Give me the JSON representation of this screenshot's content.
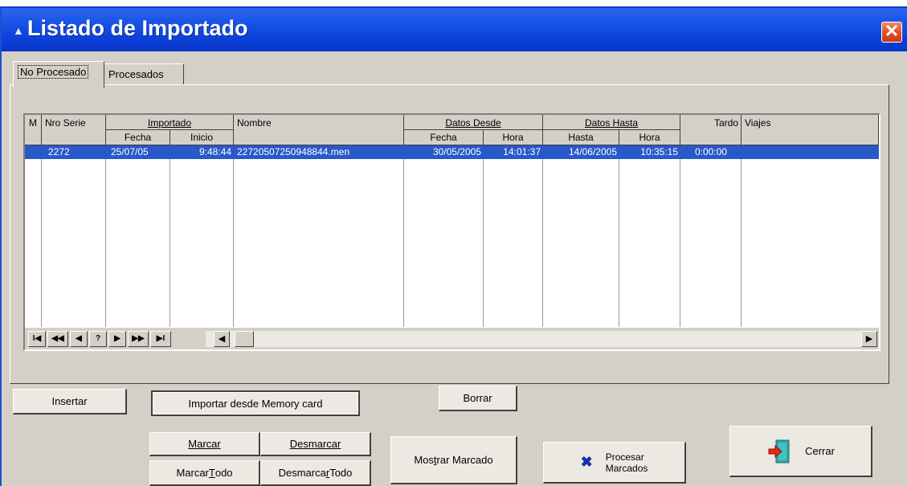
{
  "window": {
    "title": "Listado de Importado",
    "close_symbol": "✕"
  },
  "tabs": [
    {
      "label": "No Procesado",
      "active": true
    },
    {
      "label": "Procesados",
      "active": false
    }
  ],
  "grid": {
    "headers": {
      "m": "M",
      "nro_serie": "Nro Serie",
      "importado": "Importado",
      "importado_fecha": "Fecha",
      "importado_inicio": "Inicio",
      "nombre": "Nombre",
      "datos_desde": "Datos Desde",
      "desde_fecha": "Fecha",
      "desde_hora": "Hora",
      "datos_hasta": "Datos Hasta",
      "hasta_hasta": "Hasta",
      "hasta_hora": "Hora",
      "tardo": "Tardo",
      "viajes": "Viajes"
    },
    "rows": [
      {
        "m": "",
        "nro_serie": "2272",
        "imp_fecha": "25/07/05",
        "imp_inicio": "9:48:44",
        "nombre": "22720507250948844.men",
        "desde_fecha": "30/05/2005",
        "desde_hora": "14:01:37",
        "hasta_fecha": "14/06/2005",
        "hasta_hora": "10:35:15",
        "tardo": "0:00:00",
        "viajes": "",
        "selected": true
      }
    ]
  },
  "navigator": {
    "first": "I◀",
    "prev_page": "◀◀",
    "prev": "◀",
    "help": "?",
    "next": "▶",
    "next_page": "▶▶",
    "last": "▶I",
    "scroll_left": "◀",
    "scroll_right": "▶"
  },
  "buttons": {
    "insertar": "Insertar",
    "importar": "Importar desde Memory card",
    "borrar": "Borrar",
    "marcar": "Marcar",
    "desmarcar": "Desmarcar",
    "marcar_todo_pre": "Marcar ",
    "marcar_todo_ul": "T",
    "marcar_todo_post": "odo",
    "desmarcar_todo_pre": "Desmarca",
    "desmarcar_todo_ul": "r",
    "desmarcar_todo_post": " Todo",
    "mostrar_pre": "Mos",
    "mostrar_ul": "t",
    "mostrar_post": "rar Marcado",
    "procesar_line1": "Procesar",
    "procesar_line2": "Marcados",
    "cerrar": "Cerrar"
  },
  "icons": {
    "procesar_icon": "blue-x-icon",
    "cerrar_icon": "exit-door-icon"
  },
  "colors": {
    "selection": "#2958c8",
    "titlebar": "#1750e6",
    "close": "#e0532a"
  }
}
